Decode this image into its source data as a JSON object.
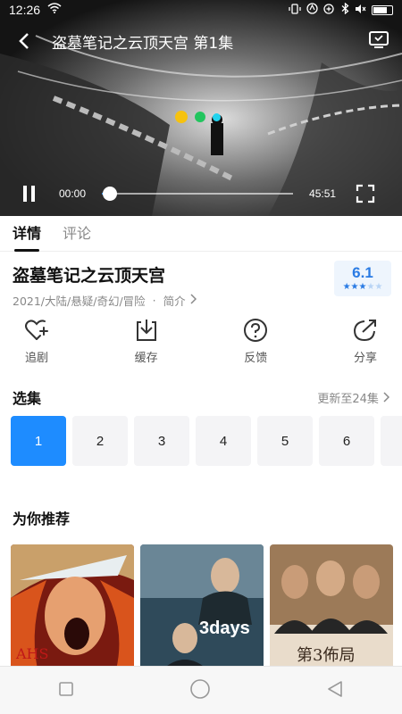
{
  "status_bar": {
    "time": "12:26"
  },
  "player": {
    "title": "盗墓笔记之云顶天宫 第1集",
    "current_time": "00:00",
    "total_time": "45:51",
    "progress": 0.04,
    "loading_dot_colors": [
      "#f6c20f",
      "#22c55e",
      "#22d3ee"
    ]
  },
  "tabs": [
    {
      "label": "详情",
      "active": true
    },
    {
      "label": "评论",
      "active": false
    }
  ],
  "show": {
    "title": "盗墓笔记之云顶天宫",
    "meta": "2021/大陆/悬疑/奇幻/冒险",
    "intro_link": "简介",
    "rating": "6.1",
    "stars_filled": 3,
    "stars_total": 5
  },
  "actions": [
    {
      "label": "追剧",
      "icon": "heart-plus-icon"
    },
    {
      "label": "缓存",
      "icon": "download-icon"
    },
    {
      "label": "反馈",
      "icon": "question-icon"
    },
    {
      "label": "分享",
      "icon": "share-icon"
    }
  ],
  "episodes": {
    "title": "选集",
    "update_text": "更新至24集",
    "items": [
      "1",
      "2",
      "3",
      "4",
      "5",
      "6",
      ""
    ],
    "active_index": 0
  },
  "recommend": {
    "title": "为你推荐",
    "items": [
      {
        "poster_text": "AHS"
      },
      {
        "poster_text": "3days"
      },
      {
        "poster_text": "第3佈局"
      }
    ]
  },
  "colors": {
    "accent": "#1e8cff",
    "rating_blue": "#2a7be4"
  }
}
